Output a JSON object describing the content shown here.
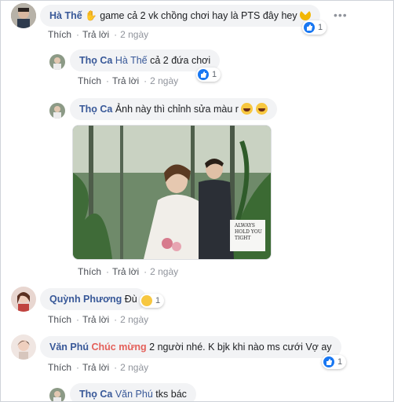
{
  "comments": [
    {
      "author": "Hà Thế",
      "text": "game cả 2 vk chồng chơi hay là PTS đây hey",
      "like": "Thích",
      "reply": "Trả lời",
      "time": "2 ngày",
      "reactions": "1"
    },
    {
      "author": "Thọ Ca",
      "tag": "Hà Thế",
      "text": "cả 2 đứa chơi",
      "like": "Thích",
      "reply": "Trả lời",
      "time": "2 ngày",
      "reactions": "1"
    },
    {
      "author": "Thọ Ca",
      "text": "Ảnh này thì chỉnh sửa màu r",
      "like": "Thích",
      "reply": "Trả lời",
      "time": "2 ngày"
    },
    {
      "author": "Quỳnh Phương",
      "text": "Đù",
      "like": "Thích",
      "reply": "Trả lời",
      "time": "2 ngày",
      "reactions": "1"
    },
    {
      "author": "Văn Phú",
      "highlight": "Chúc mừng",
      "text": "2 người nhé. K bjk khi nào ms cưới Vợ ay",
      "like": "Thích",
      "reply": "Trả lời",
      "time": "2 ngày",
      "reactions": "1"
    },
    {
      "author": "Thọ Ca",
      "tag": "Văn Phú",
      "text": "tks bác"
    }
  ],
  "photo_caption": "ALWAYS HOLD YOU TIGHT",
  "separator": "·",
  "more_label": "•••"
}
